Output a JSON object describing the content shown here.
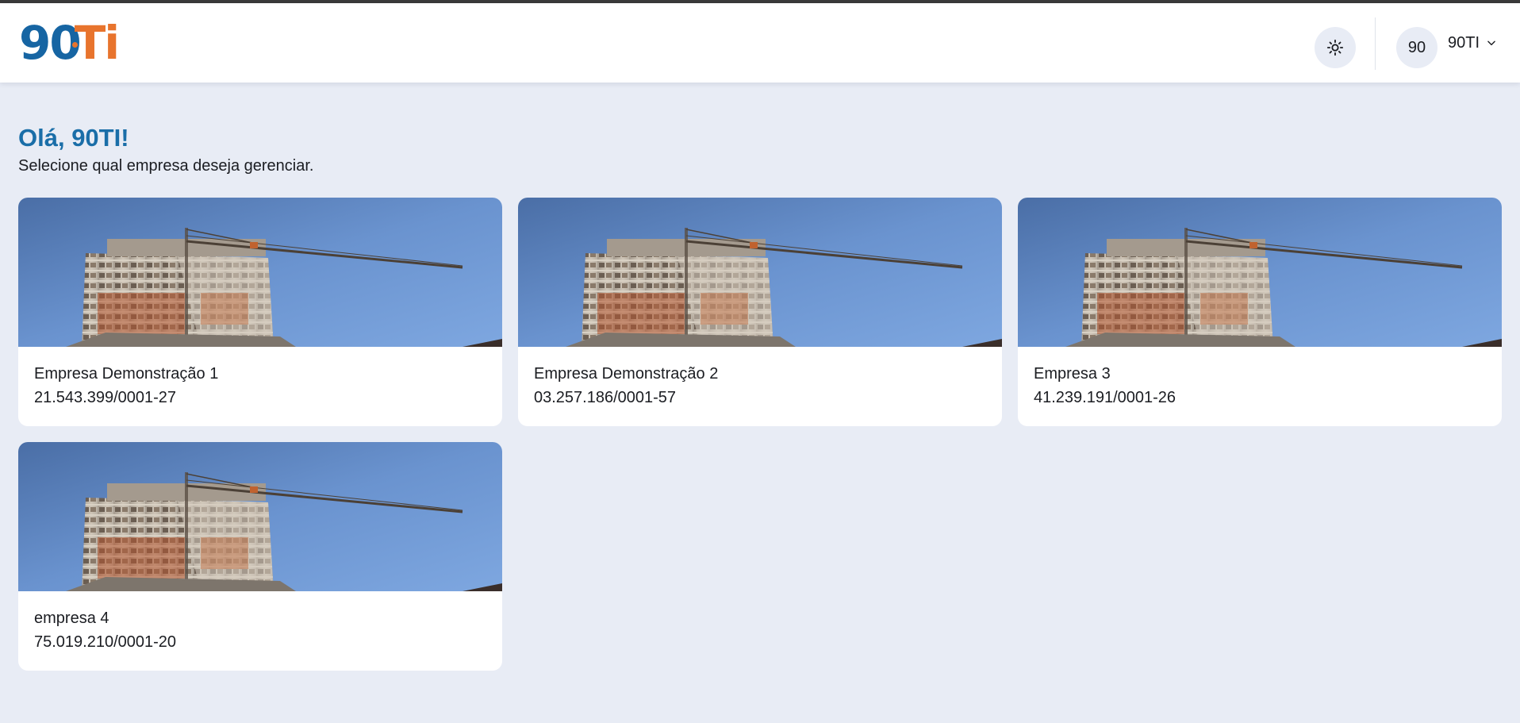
{
  "header": {
    "logo": {
      "part1": "9",
      "part2": "0",
      "part3": "Ti"
    },
    "theme_toggle_icon": "sun-icon",
    "avatar_initials": "90",
    "user_name": "90TI",
    "user_menu_icon": "chevron-down-icon"
  },
  "main": {
    "greeting": "Olá, 90TI!",
    "subtitle": "Selecione qual empresa deseja gerenciar."
  },
  "companies": [
    {
      "name": "Empresa Demonstração 1",
      "cnpj": "21.543.399/0001-27"
    },
    {
      "name": "Empresa Demonstração 2",
      "cnpj": "03.257.186/0001-57"
    },
    {
      "name": "Empresa 3",
      "cnpj": "41.239.191/0001-26"
    },
    {
      "name": "empresa 4",
      "cnpj": "75.019.210/0001-20"
    }
  ],
  "colors": {
    "brand_blue": "#1665a3",
    "brand_orange": "#e8742d",
    "greeting_blue": "#1a6ea8",
    "background": "#e8ecf5"
  }
}
